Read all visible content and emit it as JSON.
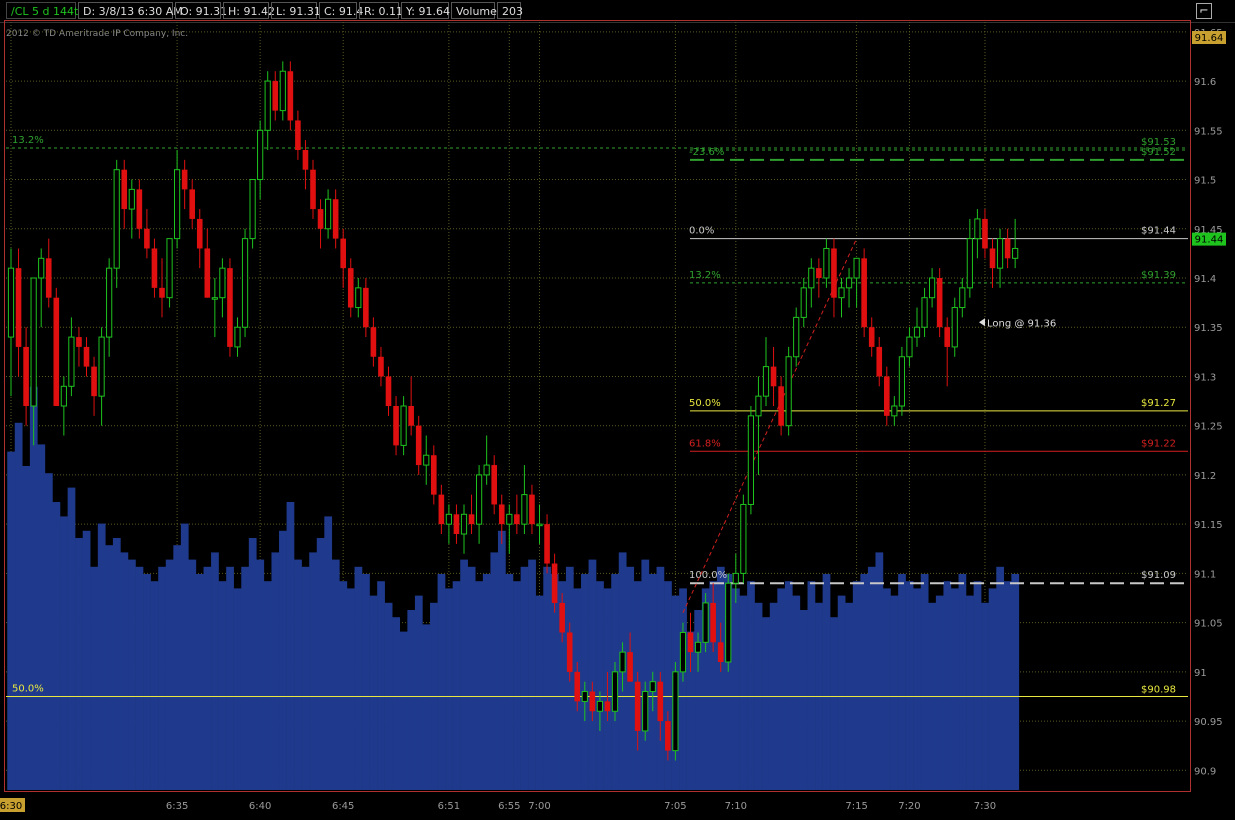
{
  "header": {
    "symbol": "/CL 5 d 144t",
    "date": "D: 3/8/13 6:30 AM",
    "open": "O: 91.31",
    "high": "H: 91.42",
    "low": "L: 91.31",
    "close": "C: 91.4",
    "range": "R: 0.11",
    "y_value": "Y: 91.64",
    "volume_label": "Volume",
    "volume_value": "203"
  },
  "copyright": "2012 © TD Ameritrade IP Company, Inc.",
  "colors": {
    "up": "#1ec31e",
    "down": "#e01010",
    "volume": "#1f3a8c",
    "fib_green": "#2fa02f",
    "fib_white": "#c8c8c8",
    "fib_yellow": "#e8e840",
    "fib_red": "#d22020",
    "grid": "#5a5a20",
    "price_badge": "#c8a030",
    "last_badge": "#1ec31e"
  },
  "chart_data": {
    "type": "candlestick",
    "ylim": [
      90.88,
      91.66
    ],
    "y_ticks": [
      "91.65",
      "91.6",
      "91.55",
      "91.5",
      "91.45",
      "91.4",
      "91.35",
      "91.3",
      "91.25",
      "91.2",
      "91.15",
      "91.1",
      "91.05",
      "91",
      "90.95",
      "90.9"
    ],
    "x_ticks": [
      {
        "label": "6:30",
        "bar": 0,
        "highlight": true
      },
      {
        "label": "6:35",
        "bar": 22
      },
      {
        "label": "6:40",
        "bar": 33
      },
      {
        "label": "6:45",
        "bar": 44
      },
      {
        "label": "6:51",
        "bar": 58
      },
      {
        "label": "6:55",
        "bar": 66
      },
      {
        "label": "7:00",
        "bar": 70
      },
      {
        "label": "7:05",
        "bar": 88
      },
      {
        "label": "7:10",
        "bar": 96
      },
      {
        "label": "7:15",
        "bar": 112
      },
      {
        "label": "7:20",
        "bar": 119
      },
      {
        "label": "7:30",
        "bar": 129
      }
    ],
    "bars": [
      {
        "o": 91.34,
        "h": 91.43,
        "l": 91.28,
        "c": 91.41
      },
      {
        "o": 91.41,
        "h": 91.43,
        "l": 91.3,
        "c": 91.33
      },
      {
        "o": 91.33,
        "h": 91.35,
        "l": 91.25,
        "c": 91.27
      },
      {
        "o": 91.27,
        "h": 91.4,
        "l": 91.23,
        "c": 91.4
      },
      {
        "o": 91.4,
        "h": 91.43,
        "l": 91.35,
        "c": 91.42
      },
      {
        "o": 91.42,
        "h": 91.44,
        "l": 91.37,
        "c": 91.38
      },
      {
        "o": 91.38,
        "h": 91.39,
        "l": 91.3,
        "c": 91.27
      },
      {
        "o": 91.27,
        "h": 91.3,
        "l": 91.24,
        "c": 91.29
      },
      {
        "o": 91.29,
        "h": 91.36,
        "l": 91.28,
        "c": 91.34
      },
      {
        "o": 91.34,
        "h": 91.35,
        "l": 91.31,
        "c": 91.33
      },
      {
        "o": 91.33,
        "h": 91.34,
        "l": 91.3,
        "c": 91.31
      },
      {
        "o": 91.31,
        "h": 91.32,
        "l": 91.26,
        "c": 91.28
      },
      {
        "o": 91.28,
        "h": 91.35,
        "l": 91.25,
        "c": 91.34
      },
      {
        "o": 91.34,
        "h": 91.42,
        "l": 91.32,
        "c": 91.41
      },
      {
        "o": 91.41,
        "h": 91.52,
        "l": 91.39,
        "c": 91.51
      },
      {
        "o": 91.51,
        "h": 91.52,
        "l": 91.45,
        "c": 91.47
      },
      {
        "o": 91.47,
        "h": 91.5,
        "l": 91.44,
        "c": 91.49
      },
      {
        "o": 91.49,
        "h": 91.5,
        "l": 91.44,
        "c": 91.45
      },
      {
        "o": 91.45,
        "h": 91.47,
        "l": 91.42,
        "c": 91.43
      },
      {
        "o": 91.43,
        "h": 91.44,
        "l": 91.38,
        "c": 91.39
      },
      {
        "o": 91.39,
        "h": 91.42,
        "l": 91.36,
        "c": 91.38
      },
      {
        "o": 91.38,
        "h": 91.44,
        "l": 91.37,
        "c": 91.44
      },
      {
        "o": 91.44,
        "h": 91.53,
        "l": 91.43,
        "c": 91.51
      },
      {
        "o": 91.51,
        "h": 91.52,
        "l": 91.47,
        "c": 91.49
      },
      {
        "o": 91.49,
        "h": 91.5,
        "l": 91.45,
        "c": 91.46
      },
      {
        "o": 91.46,
        "h": 91.47,
        "l": 91.41,
        "c": 91.43
      },
      {
        "o": 91.43,
        "h": 91.45,
        "l": 91.38,
        "c": 91.38
      },
      {
        "o": 91.38,
        "h": 91.4,
        "l": 91.34,
        "c": 91.38
      },
      {
        "o": 91.38,
        "h": 91.42,
        "l": 91.36,
        "c": 91.41
      },
      {
        "o": 91.41,
        "h": 91.42,
        "l": 91.32,
        "c": 91.33
      },
      {
        "o": 91.33,
        "h": 91.36,
        "l": 91.32,
        "c": 91.35
      },
      {
        "o": 91.35,
        "h": 91.45,
        "l": 91.34,
        "c": 91.44
      },
      {
        "o": 91.44,
        "h": 91.5,
        "l": 91.43,
        "c": 91.5
      },
      {
        "o": 91.5,
        "h": 91.56,
        "l": 91.48,
        "c": 91.55
      },
      {
        "o": 91.55,
        "h": 91.61,
        "l": 91.53,
        "c": 91.6
      },
      {
        "o": 91.6,
        "h": 91.61,
        "l": 91.56,
        "c": 91.57
      },
      {
        "o": 91.57,
        "h": 91.62,
        "l": 91.56,
        "c": 91.61
      },
      {
        "o": 91.61,
        "h": 91.62,
        "l": 91.55,
        "c": 91.56
      },
      {
        "o": 91.56,
        "h": 91.57,
        "l": 91.52,
        "c": 91.53
      },
      {
        "o": 91.53,
        "h": 91.54,
        "l": 91.49,
        "c": 91.51
      },
      {
        "o": 91.51,
        "h": 91.52,
        "l": 91.46,
        "c": 91.47
      },
      {
        "o": 91.47,
        "h": 91.48,
        "l": 91.43,
        "c": 91.45
      },
      {
        "o": 91.45,
        "h": 91.49,
        "l": 91.44,
        "c": 91.48
      },
      {
        "o": 91.48,
        "h": 91.49,
        "l": 91.43,
        "c": 91.44
      },
      {
        "o": 91.44,
        "h": 91.45,
        "l": 91.39,
        "c": 91.41
      },
      {
        "o": 91.41,
        "h": 91.42,
        "l": 91.36,
        "c": 91.37
      },
      {
        "o": 91.37,
        "h": 91.4,
        "l": 91.36,
        "c": 91.39
      },
      {
        "o": 91.39,
        "h": 91.4,
        "l": 91.34,
        "c": 91.35
      },
      {
        "o": 91.35,
        "h": 91.36,
        "l": 91.31,
        "c": 91.32
      },
      {
        "o": 91.32,
        "h": 91.33,
        "l": 91.29,
        "c": 91.3
      },
      {
        "o": 91.3,
        "h": 91.31,
        "l": 91.26,
        "c": 91.27
      },
      {
        "o": 91.27,
        "h": 91.28,
        "l": 91.22,
        "c": 91.23
      },
      {
        "o": 91.23,
        "h": 91.28,
        "l": 91.22,
        "c": 91.27
      },
      {
        "o": 91.27,
        "h": 91.3,
        "l": 91.24,
        "c": 91.25
      },
      {
        "o": 91.25,
        "h": 91.26,
        "l": 91.2,
        "c": 91.21
      },
      {
        "o": 91.21,
        "h": 91.24,
        "l": 91.19,
        "c": 91.22
      },
      {
        "o": 91.22,
        "h": 91.23,
        "l": 91.17,
        "c": 91.18
      },
      {
        "o": 91.18,
        "h": 91.19,
        "l": 91.14,
        "c": 91.15
      },
      {
        "o": 91.15,
        "h": 91.17,
        "l": 91.13,
        "c": 91.16
      },
      {
        "o": 91.16,
        "h": 91.17,
        "l": 91.13,
        "c": 91.14
      },
      {
        "o": 91.14,
        "h": 91.17,
        "l": 91.12,
        "c": 91.16
      },
      {
        "o": 91.16,
        "h": 91.18,
        "l": 91.14,
        "c": 91.15
      },
      {
        "o": 91.15,
        "h": 91.21,
        "l": 91.13,
        "c": 91.2
      },
      {
        "o": 91.2,
        "h": 91.24,
        "l": 91.19,
        "c": 91.21
      },
      {
        "o": 91.21,
        "h": 91.22,
        "l": 91.16,
        "c": 91.17
      },
      {
        "o": 91.17,
        "h": 91.18,
        "l": 91.13,
        "c": 91.15
      },
      {
        "o": 91.15,
        "h": 91.17,
        "l": 91.12,
        "c": 91.16
      },
      {
        "o": 91.16,
        "h": 91.18,
        "l": 91.14,
        "c": 91.15
      },
      {
        "o": 91.15,
        "h": 91.21,
        "l": 91.14,
        "c": 91.18
      },
      {
        "o": 91.18,
        "h": 91.19,
        "l": 91.14,
        "c": 91.15
      },
      {
        "o": 91.15,
        "h": 91.17,
        "l": 91.13,
        "c": 91.15
      },
      {
        "o": 91.15,
        "h": 91.16,
        "l": 91.1,
        "c": 91.11
      },
      {
        "o": 91.11,
        "h": 91.12,
        "l": 91.06,
        "c": 91.07
      },
      {
        "o": 91.07,
        "h": 91.08,
        "l": 91.03,
        "c": 91.04
      },
      {
        "o": 91.04,
        "h": 91.05,
        "l": 90.99,
        "c": 91.0
      },
      {
        "o": 91.0,
        "h": 91.01,
        "l": 90.96,
        "c": 90.97
      },
      {
        "o": 90.97,
        "h": 90.99,
        "l": 90.95,
        "c": 90.98
      },
      {
        "o": 90.98,
        "h": 90.99,
        "l": 90.95,
        "c": 90.96
      },
      {
        "o": 90.96,
        "h": 90.98,
        "l": 90.94,
        "c": 90.97
      },
      {
        "o": 90.97,
        "h": 91.0,
        "l": 90.95,
        "c": 90.96
      },
      {
        "o": 90.96,
        "h": 91.01,
        "l": 90.95,
        "c": 91.0
      },
      {
        "o": 91.0,
        "h": 91.03,
        "l": 90.98,
        "c": 91.02
      },
      {
        "o": 91.02,
        "h": 91.04,
        "l": 91.0,
        "c": 90.99
      },
      {
        "o": 90.99,
        "h": 91.0,
        "l": 90.92,
        "c": 90.94
      },
      {
        "o": 90.94,
        "h": 90.99,
        "l": 90.93,
        "c": 90.98
      },
      {
        "o": 90.98,
        "h": 91.0,
        "l": 90.96,
        "c": 90.99
      },
      {
        "o": 90.99,
        "h": 91.0,
        "l": 90.93,
        "c": 90.95
      },
      {
        "o": 90.95,
        "h": 90.96,
        "l": 90.91,
        "c": 90.92
      },
      {
        "o": 90.92,
        "h": 91.01,
        "l": 90.91,
        "c": 91.0
      },
      {
        "o": 91.0,
        "h": 91.05,
        "l": 90.99,
        "c": 91.04
      },
      {
        "o": 91.04,
        "h": 91.06,
        "l": 91.0,
        "c": 91.02
      },
      {
        "o": 91.02,
        "h": 91.04,
        "l": 91.0,
        "c": 91.03
      },
      {
        "o": 91.03,
        "h": 91.08,
        "l": 91.02,
        "c": 91.07
      },
      {
        "o": 91.07,
        "h": 91.09,
        "l": 91.02,
        "c": 91.03
      },
      {
        "o": 91.03,
        "h": 91.05,
        "l": 91.0,
        "c": 91.01
      },
      {
        "o": 91.01,
        "h": 91.1,
        "l": 91.0,
        "c": 91.09
      },
      {
        "o": 91.09,
        "h": 91.12,
        "l": 91.07,
        "c": 91.1
      },
      {
        "o": 91.1,
        "h": 91.18,
        "l": 91.09,
        "c": 91.17
      },
      {
        "o": 91.17,
        "h": 91.27,
        "l": 91.16,
        "c": 91.26
      },
      {
        "o": 91.26,
        "h": 91.3,
        "l": 91.2,
        "c": 91.28
      },
      {
        "o": 91.28,
        "h": 91.34,
        "l": 91.27,
        "c": 91.31
      },
      {
        "o": 91.31,
        "h": 91.33,
        "l": 91.27,
        "c": 91.29
      },
      {
        "o": 91.29,
        "h": 91.3,
        "l": 91.24,
        "c": 91.25
      },
      {
        "o": 91.25,
        "h": 91.33,
        "l": 91.24,
        "c": 91.32
      },
      {
        "o": 91.32,
        "h": 91.37,
        "l": 91.31,
        "c": 91.36
      },
      {
        "o": 91.36,
        "h": 91.4,
        "l": 91.35,
        "c": 91.39
      },
      {
        "o": 91.39,
        "h": 91.42,
        "l": 91.37,
        "c": 91.41
      },
      {
        "o": 91.41,
        "h": 91.42,
        "l": 91.38,
        "c": 91.4
      },
      {
        "o": 91.4,
        "h": 91.44,
        "l": 91.39,
        "c": 91.43
      },
      {
        "o": 91.43,
        "h": 91.44,
        "l": 91.36,
        "c": 91.38
      },
      {
        "o": 91.38,
        "h": 91.4,
        "l": 91.36,
        "c": 91.39
      },
      {
        "o": 91.39,
        "h": 91.41,
        "l": 91.37,
        "c": 91.4
      },
      {
        "o": 91.4,
        "h": 91.42,
        "l": 91.37,
        "c": 91.42
      },
      {
        "o": 91.42,
        "h": 91.43,
        "l": 91.34,
        "c": 91.35
      },
      {
        "o": 91.35,
        "h": 91.36,
        "l": 91.32,
        "c": 91.33
      },
      {
        "o": 91.33,
        "h": 91.34,
        "l": 91.29,
        "c": 91.3
      },
      {
        "o": 91.3,
        "h": 91.31,
        "l": 91.25,
        "c": 91.26
      },
      {
        "o": 91.26,
        "h": 91.28,
        "l": 91.25,
        "c": 91.27
      },
      {
        "o": 91.27,
        "h": 91.33,
        "l": 91.26,
        "c": 91.32
      },
      {
        "o": 91.32,
        "h": 91.35,
        "l": 91.31,
        "c": 91.34
      },
      {
        "o": 91.34,
        "h": 91.37,
        "l": 91.33,
        "c": 91.35
      },
      {
        "o": 91.35,
        "h": 91.39,
        "l": 91.34,
        "c": 91.38
      },
      {
        "o": 91.38,
        "h": 91.41,
        "l": 91.37,
        "c": 91.4
      },
      {
        "o": 91.4,
        "h": 91.41,
        "l": 91.34,
        "c": 91.35
      },
      {
        "o": 91.35,
        "h": 91.36,
        "l": 91.29,
        "c": 91.33
      },
      {
        "o": 91.33,
        "h": 91.38,
        "l": 91.32,
        "c": 91.37
      },
      {
        "o": 91.37,
        "h": 91.4,
        "l": 91.36,
        "c": 91.39
      },
      {
        "o": 91.39,
        "h": 91.46,
        "l": 91.38,
        "c": 91.44
      },
      {
        "o": 91.44,
        "h": 91.47,
        "l": 91.42,
        "c": 91.46
      },
      {
        "o": 91.46,
        "h": 91.47,
        "l": 91.42,
        "c": 91.43
      },
      {
        "o": 91.43,
        "h": 91.44,
        "l": 91.39,
        "c": 91.41
      },
      {
        "o": 91.41,
        "h": 91.45,
        "l": 91.39,
        "c": 91.44
      },
      {
        "o": 91.44,
        "h": 91.45,
        "l": 91.41,
        "c": 91.42
      },
      {
        "o": 91.42,
        "h": 91.46,
        "l": 91.41,
        "c": 91.43
      }
    ],
    "volume": [
      94,
      102,
      90,
      112,
      96,
      88,
      80,
      76,
      84,
      70,
      72,
      62,
      74,
      68,
      70,
      66,
      64,
      62,
      60,
      58,
      62,
      64,
      68,
      74,
      64,
      60,
      62,
      66,
      58,
      62,
      56,
      62,
      70,
      64,
      58,
      66,
      72,
      80,
      64,
      62,
      66,
      70,
      76,
      64,
      58,
      56,
      62,
      60,
      54,
      58,
      52,
      48,
      44,
      50,
      54,
      46,
      52,
      60,
      56,
      58,
      64,
      62,
      58,
      60,
      66,
      72,
      60,
      58,
      62,
      64,
      54,
      62,
      60,
      58,
      62,
      56,
      60,
      64,
      58,
      56,
      60,
      66,
      62,
      58,
      64,
      60,
      62,
      58,
      54,
      56,
      44,
      50,
      56,
      58,
      62,
      60,
      56,
      54,
      58,
      52,
      48,
      52,
      56,
      58,
      54,
      50,
      58,
      52,
      60,
      48,
      54,
      52,
      58,
      60,
      62,
      66,
      56,
      54,
      60,
      58,
      56,
      60,
      52,
      54,
      58,
      56,
      60,
      54,
      58,
      52,
      56,
      62,
      58,
      60,
      64
    ],
    "fib_sets": [
      {
        "levels": [
          {
            "label": "13.2%",
            "price": 91.532,
            "color": "fib_green",
            "dash": "dashed"
          },
          {
            "label": "50.0%",
            "price": 90.975,
            "color": "fib_yellow",
            "dash": "solid"
          }
        ]
      },
      {
        "levels": [
          {
            "label": "-23.6%",
            "price": 91.52,
            "value": "$91.52",
            "color": "fib_green",
            "dash": "longdash"
          },
          {
            "label": "",
            "price": 91.53,
            "value": "$91.53",
            "color": "fib_green",
            "dash": "dashed"
          },
          {
            "label": "0.0%",
            "price": 91.44,
            "value": "$91.44",
            "color": "fib_white",
            "dash": "solid"
          },
          {
            "label": "13.2%",
            "price": 91.395,
            "value": "$91.39",
            "color": "fib_green",
            "dash": "dashed"
          },
          {
            "label": "50.0%",
            "price": 91.265,
            "value": "$91.27",
            "color": "fib_yellow",
            "dash": "solid"
          },
          {
            "label": "61.8%",
            "price": 91.224,
            "value": "$91.22",
            "color": "fib_red",
            "dash": "solid"
          },
          {
            "label": "100.0%",
            "price": 91.09,
            "value": "$91.09",
            "color": "fib_white",
            "dash": "longdash"
          }
        ]
      }
    ],
    "left_fib_value": "$90.98",
    "annotation": "Long @ 91.36",
    "price_badge": "91.64",
    "last_price_badge": "91.44"
  }
}
